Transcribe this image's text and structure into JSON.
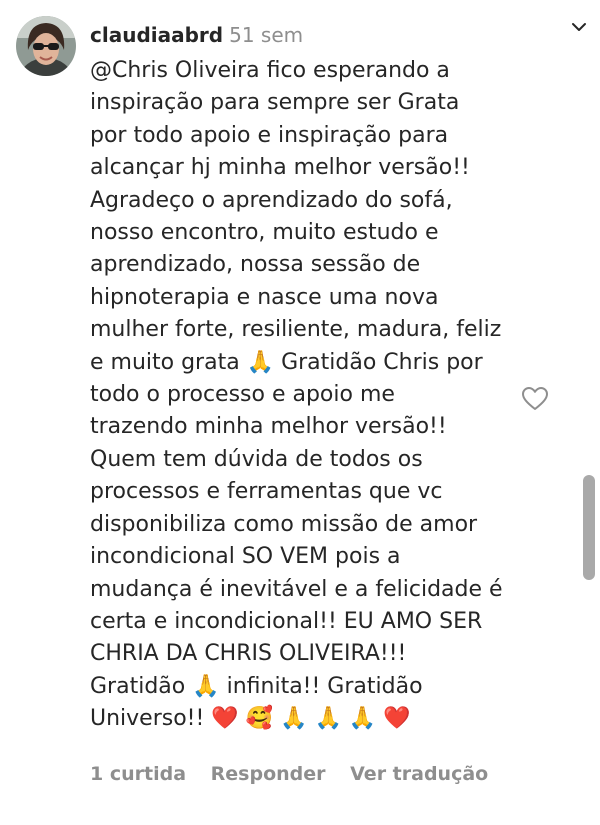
{
  "comment": {
    "username": "claudiaabrd",
    "time": "51 sem",
    "lines": [
      "@Chris Oliveira fico esperando a",
      "inspiração para sempre ser Grata",
      "por todo apoio e inspiração para",
      "alcançar hj minha melhor versão!!",
      "Agradeço o aprendizado do sofá,",
      "nosso encontro, muito estudo e",
      "aprendizado, nossa sessão de",
      "hipnoterapia e nasce uma nova",
      "mulher forte, resiliente, madura, feliz",
      "e muito grata 🙏 Gratidão Chris por",
      "todo o processo e apoio me",
      "trazendo minha melhor versão!!",
      "Quem tem dúvida de todos os",
      "processos e ferramentas que vc",
      "disponibiliza como missão de amor",
      "incondicional SO VEM pois a",
      "mudança é inevitável e a felicidade é",
      "certa e incondicional!! EU AMO SER",
      "CHRIA DA CHRIS OLIVEIRA!!!",
      "Gratidão 🙏 infinita!! Gratidão",
      "Universo!! ❤️ 🥰 🙏 🙏 🙏 ❤️"
    ]
  },
  "actions": {
    "likes": "1 curtida",
    "reply": "Responder",
    "translate": "Ver tradução"
  },
  "icons": {
    "more": "more-options-icon",
    "like": "heart-outline-icon"
  },
  "colors": {
    "text": "#262626",
    "muted": "#8e8e8e",
    "background": "#ffffff"
  }
}
